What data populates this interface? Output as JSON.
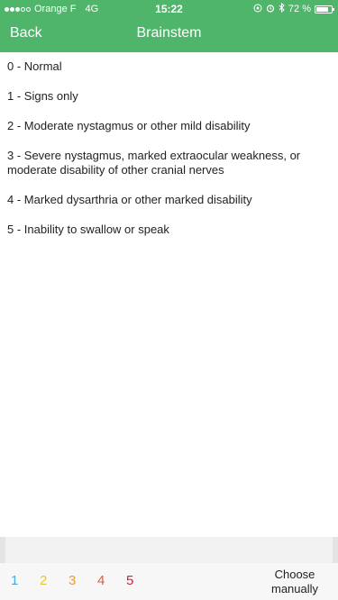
{
  "status_bar": {
    "carrier": "Orange F",
    "network": "4G",
    "time": "15:22",
    "battery": "72 %"
  },
  "header": {
    "back_label": "Back",
    "title": "Brainstem"
  },
  "items": [
    {
      "text": "0 - Normal"
    },
    {
      "text": "1 - Signs only"
    },
    {
      "text": "2 - Moderate nystagmus or other mild disability"
    },
    {
      "text": "3 - Severe nystagmus, marked extraocular weakness, or moderate disability of other cranial nerves"
    },
    {
      "text": "4 - Marked dysarthria or other marked disability"
    },
    {
      "text": "5 - Inability to swallow or speak"
    }
  ],
  "bottom_bar": {
    "scores": [
      {
        "label": "1",
        "color": "#4ba9e0"
      },
      {
        "label": "2",
        "color": "#e8c440"
      },
      {
        "label": "3",
        "color": "#ea9a3a"
      },
      {
        "label": "4",
        "color": "#e2583a"
      },
      {
        "label": "5",
        "color": "#d1223a"
      }
    ],
    "manual_label": "Choose manually"
  },
  "colors": {
    "header": "#4fb56b"
  }
}
